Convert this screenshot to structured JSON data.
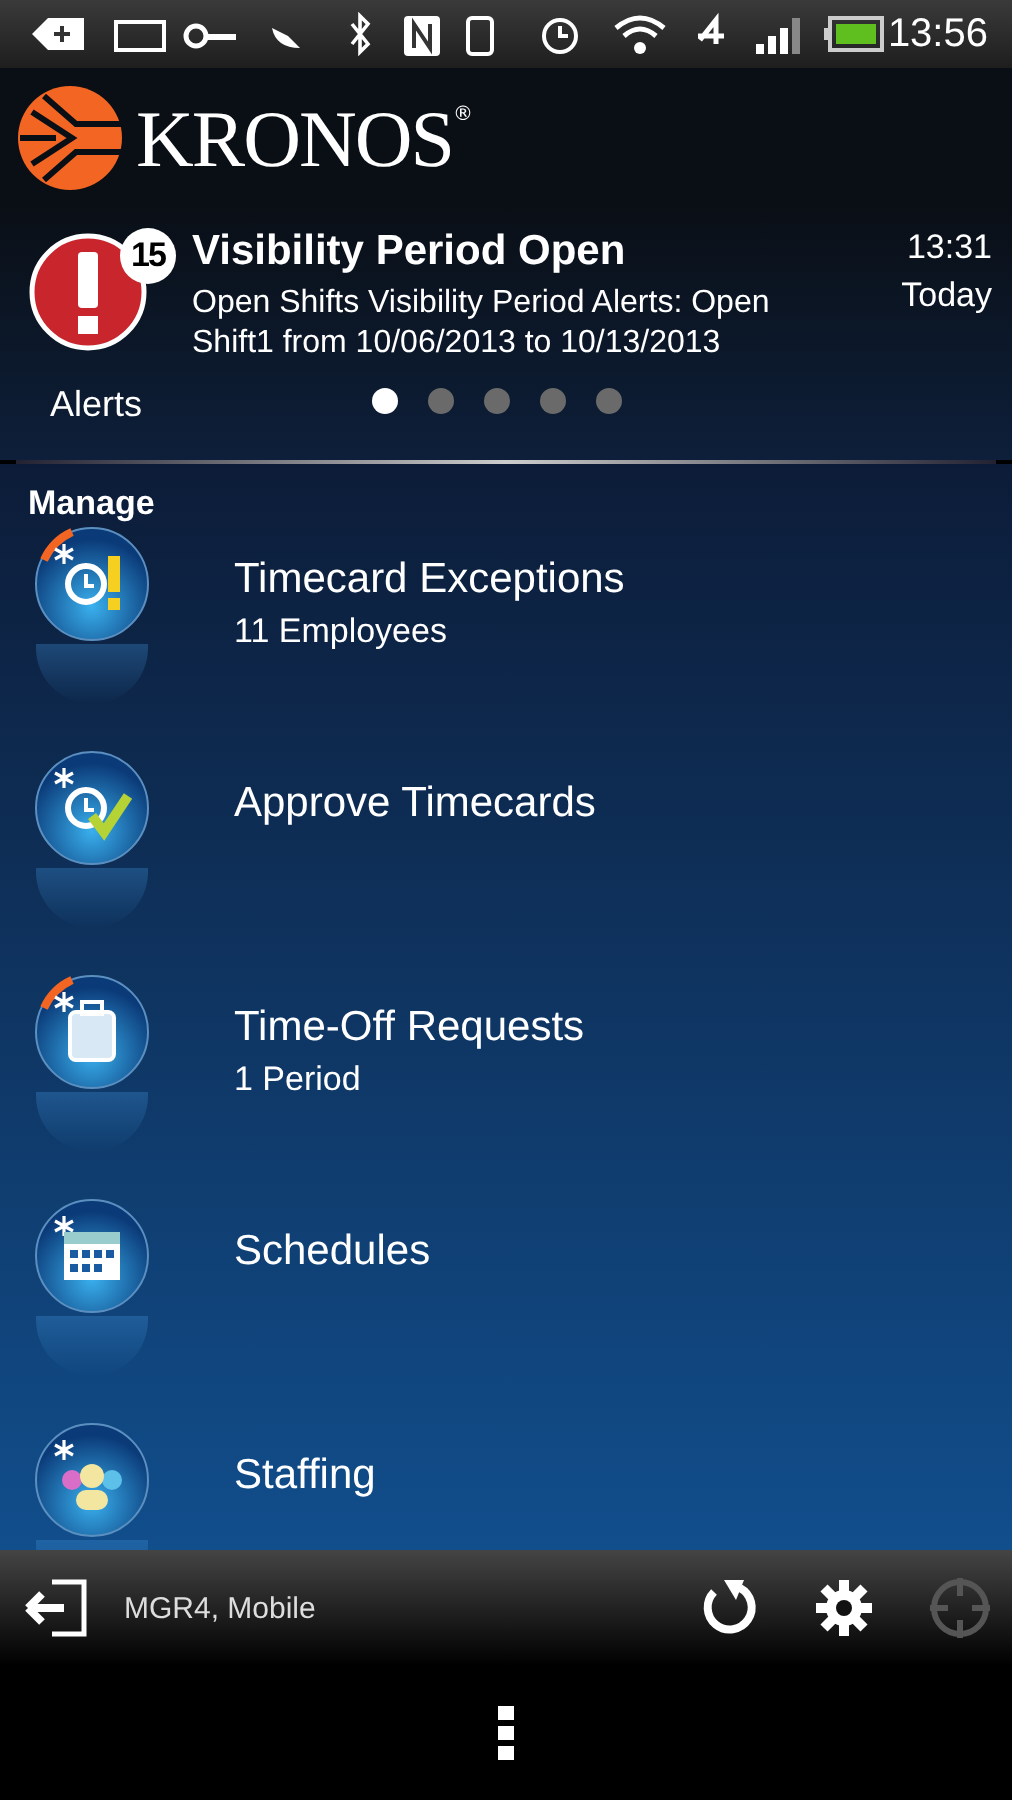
{
  "status_bar": {
    "time": "13:56"
  },
  "header": {
    "logo": "KRONOS",
    "registered": "®"
  },
  "alert": {
    "label": "Alerts",
    "count": "15",
    "title": "Visibility Period Open",
    "body": "Open Shifts Visibility Period Alerts: Open Shift1 from 10/06/2013 to 10/13/2013",
    "time": "13:31",
    "day": "Today",
    "pages": [
      {
        "selected": true
      },
      {
        "selected": false
      },
      {
        "selected": false
      },
      {
        "selected": false
      },
      {
        "selected": false
      }
    ]
  },
  "section": "Manage",
  "items": [
    {
      "kind": "exceptions",
      "title": "Timecard Exceptions",
      "subtitle": "11 Employees",
      "flagged": true
    },
    {
      "kind": "approve",
      "title": "Approve Timecards",
      "flagged": false
    },
    {
      "kind": "timeoff",
      "title": "Time-Off Requests",
      "subtitle": "1 Period",
      "flagged": true
    },
    {
      "kind": "schedules",
      "title": "Schedules",
      "flagged": false
    },
    {
      "kind": "staffing",
      "title": "Staffing",
      "flagged": false
    }
  ],
  "bottom_bar": {
    "user": "MGR4, Mobile",
    "actions": [
      {
        "kind": "refresh",
        "disabled": false
      },
      {
        "kind": "settings",
        "disabled": false
      },
      {
        "kind": "locate",
        "disabled": true
      }
    ]
  }
}
